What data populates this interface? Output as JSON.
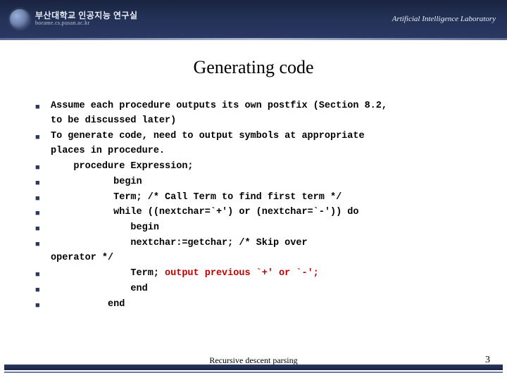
{
  "header": {
    "korean": "부산대학교 인공지능 연구실",
    "url": "borame.cs.pusan.ac.kr",
    "lab": "Artificial Intelligence Laboratory"
  },
  "title": "Generating code",
  "bullets": [
    {
      "text": "Assume each procedure outputs its own postfix (Section 8.2,\nto be discussed later)"
    },
    {
      "text": "To generate code, need to output symbols at appropriate\nplaces in procedure."
    },
    {
      "text": "    procedure Expression;"
    },
    {
      "text": "           begin"
    },
    {
      "text": "           Term; /* Call Term to find first term */"
    },
    {
      "text": "           while ((nextchar=`+') or (nextchar=`-')) do"
    },
    {
      "text": "              begin"
    },
    {
      "text": "              nextchar:=getchar; /* Skip over\noperator */"
    },
    {
      "text": "              Term; ",
      "hl": "output previous `+' or `-';"
    },
    {
      "text": "              end"
    },
    {
      "text": "          end"
    }
  ],
  "footer": {
    "caption": "Recursive descent parsing",
    "page": "3"
  }
}
